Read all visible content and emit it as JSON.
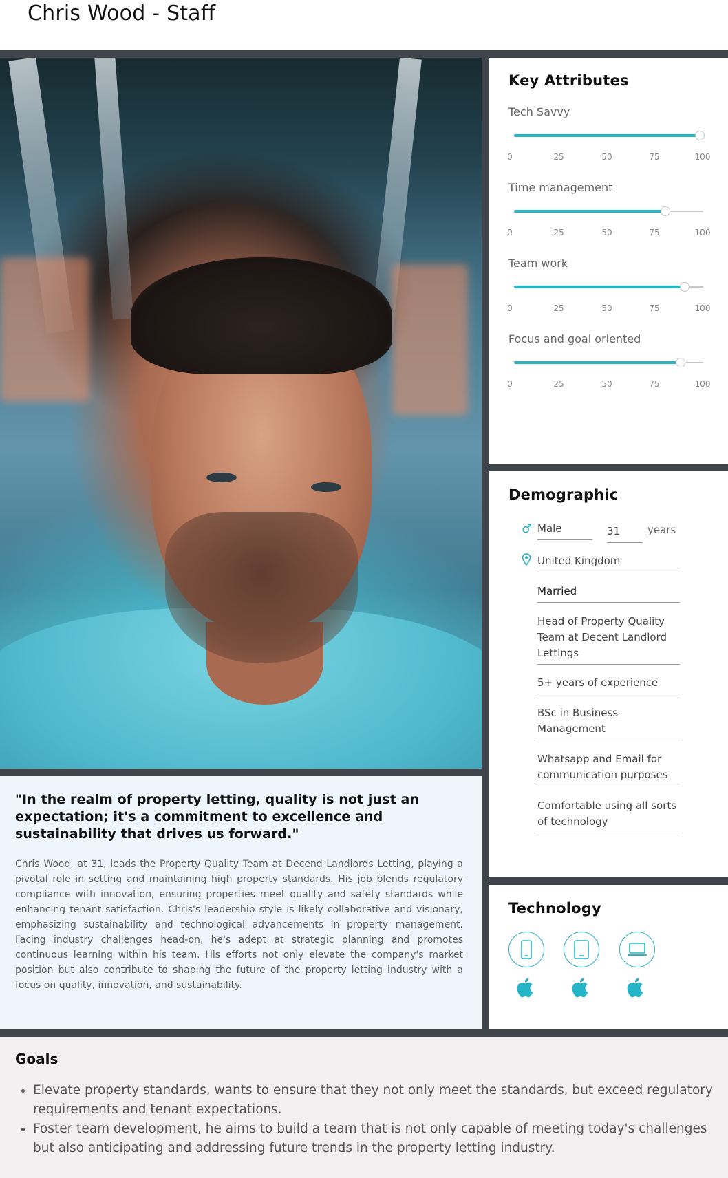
{
  "header": {
    "title": "Chris Wood - Staff"
  },
  "quote": "\"In the realm of property letting, quality is not just an expectation; it's a commitment to excellence and sustainability that drives us forward.\"",
  "bio": "Chris Wood, at 31, leads the Property Quality Team at Decend Landlords Letting, playing a pivotal role in setting and maintaining high property standards. His job blends regulatory compliance with innovation, ensuring properties meet quality and safety standards while enhancing tenant satisfaction. Chris's leadership style is likely collaborative and visionary, emphasizing sustainability and technological advancements in property management. Facing industry challenges head-on, he's adept at strategic planning and promotes continuous learning within his team. His efforts not only elevate the company's market position but also contribute to shaping the future of the property letting industry with a focus on quality, innovation, and sustainability.",
  "key_attributes": {
    "title": "Key Attributes",
    "ticks": [
      "0",
      "25",
      "50",
      "75",
      "100"
    ],
    "sliders": [
      {
        "label": "Tech Savvy",
        "value": 98
      },
      {
        "label": "Time management",
        "value": 80
      },
      {
        "label": "Team work",
        "value": 90
      },
      {
        "label": "Focus and goal oriented",
        "value": 88
      }
    ]
  },
  "demographic": {
    "title": "Demographic",
    "gender": "Male",
    "age": "31",
    "age_unit": "years",
    "location": "United Kingdom",
    "marital_status": "Married",
    "job": "Head of Property Quality Team at Decent Landlord Lettings",
    "experience": "5+ years of experience",
    "education": "BSc in Business Management",
    "communication": "Whatsapp and Email for communication purposes",
    "tech_comfort": "Comfortable using all sorts of technology"
  },
  "technology": {
    "title": "Technology",
    "devices": [
      "phone-icon",
      "tablet-icon",
      "laptop-icon"
    ],
    "platform": "apple-icon"
  },
  "goals": {
    "title": "Goals",
    "items": [
      "Elevate property standards, wants to ensure that they not only meet the standards, but exceed regulatory requirements and tenant expectations.",
      "Foster team development, he aims to build a team that is not only capable of meeting today's challenges but also anticipating and addressing future trends in the property letting industry."
    ]
  },
  "colors": {
    "accent": "#26b5c6",
    "frame": "#40454c",
    "quote_bg": "#eef5fd",
    "goals_bg": "#f3eef0"
  }
}
